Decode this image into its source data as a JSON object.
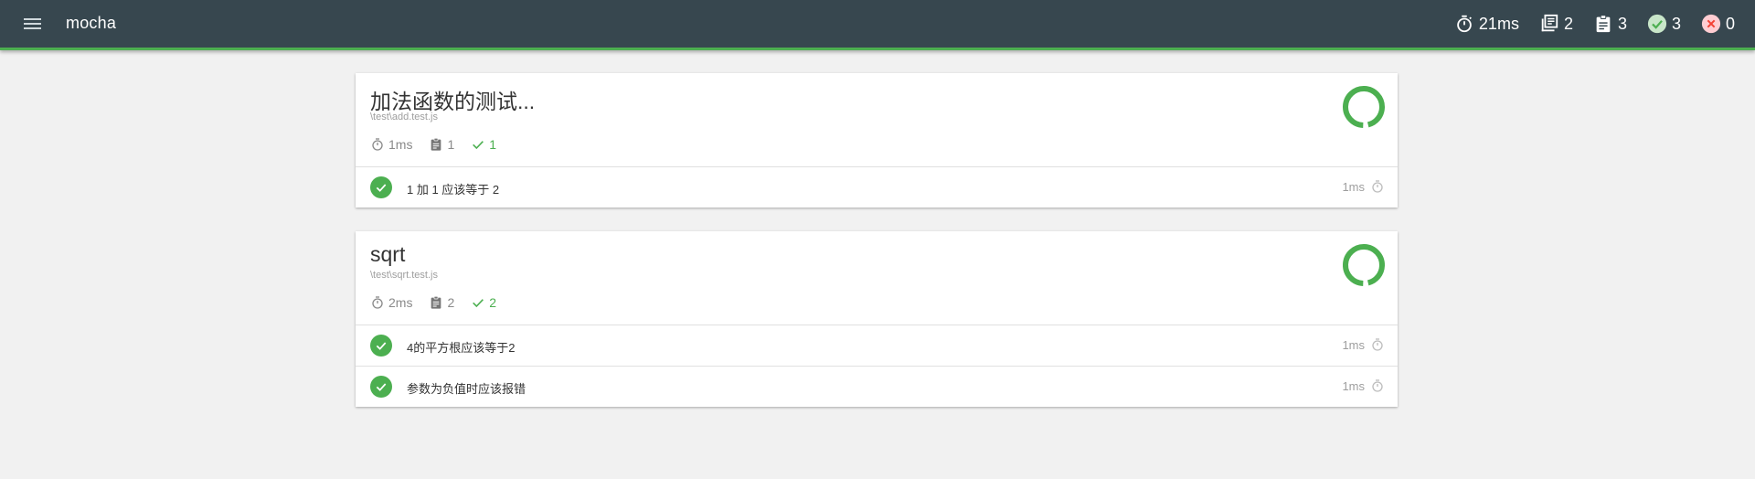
{
  "app": {
    "title": "mocha"
  },
  "stats": {
    "duration": "21ms",
    "suites": "2",
    "tests": "3",
    "passes": "3",
    "failures": "0"
  },
  "colors": {
    "pass": "#4caf50",
    "fail": "#f44336",
    "topbar": "#37474f"
  },
  "suites": [
    {
      "title": "加法函数的测试...",
      "file": "\\test\\add.test.js",
      "duration": "1ms",
      "tests": "1",
      "passes": "1",
      "pass_fraction": 1.0,
      "items": [
        {
          "name": "1 加 1 应该等于 2",
          "duration": "1ms",
          "status": "passed"
        }
      ]
    },
    {
      "title": "sqrt",
      "file": "\\test\\sqrt.test.js",
      "duration": "2ms",
      "tests": "2",
      "passes": "2",
      "pass_fraction": 1.0,
      "items": [
        {
          "name": "4的平方根应该等于2",
          "duration": "1ms",
          "status": "passed"
        },
        {
          "name": "参数为负值时应该报错",
          "duration": "1ms",
          "status": "passed"
        }
      ]
    }
  ]
}
